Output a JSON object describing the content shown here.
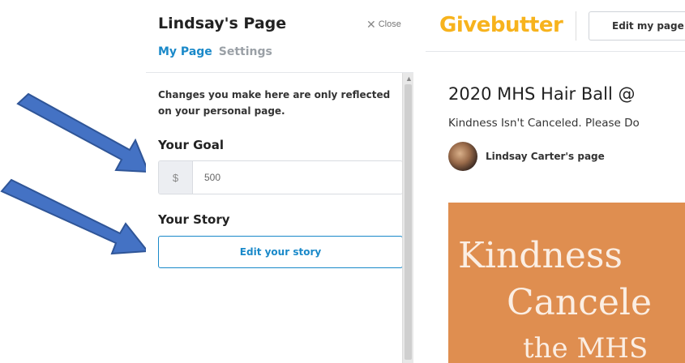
{
  "panel": {
    "title": "Lindsay's Page",
    "close_label": "Close",
    "tabs": [
      {
        "label": "My Page",
        "active": true
      },
      {
        "label": "Settings",
        "active": false
      }
    ],
    "info_text": "Changes you make here are only reflected on your personal page.",
    "goal": {
      "label": "Your Goal",
      "currency_symbol": "$",
      "value": "500"
    },
    "story": {
      "label": "Your Story",
      "button_label": "Edit your story"
    }
  },
  "main": {
    "logo": "Givebutter",
    "edit_page_label": "Edit my page",
    "campaign_title": "2020 MHS Hair Ball @",
    "campaign_subtitle": "Kindness Isn't Canceled. Please Do",
    "owner_name": "Lindsay Carter's page",
    "hero_lines": [
      "Kindness",
      "Cancele",
      "the MHS"
    ]
  },
  "colors": {
    "accent": "#1a89c9",
    "logo": "#f7b31d",
    "hero_bg": "#df8e50",
    "arrow": "#4472c4"
  },
  "icons": [
    "close-icon",
    "arrow-annotation-icon",
    "scroll-up-icon"
  ]
}
